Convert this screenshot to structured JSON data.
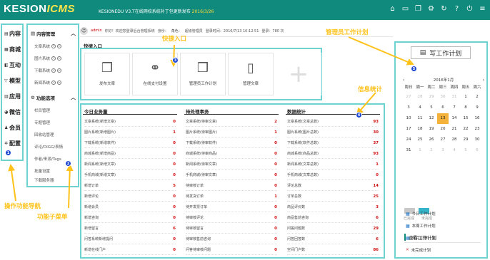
{
  "header": {
    "logo_main": "KESION",
    "logo_accent": "ICMS",
    "version_text": "KESIONEDU V3.T在线网校系统补丁包更新发布",
    "version_date": "2016/3/26",
    "icons": [
      "home-icon",
      "monitor-icon",
      "copy-icon",
      "gear-icon",
      "refresh-icon",
      "help-icon",
      "power-icon",
      "menu-icon"
    ]
  },
  "leftnav": {
    "items": [
      {
        "icon": "file-icon",
        "label": "内容"
      },
      {
        "icon": "shop-icon",
        "label": "商城"
      },
      {
        "icon": "interact-icon",
        "label": "互动"
      },
      {
        "icon": "model-icon",
        "label": "模型"
      },
      {
        "icon": "app-icon",
        "label": "应用"
      },
      {
        "icon": "wechat-icon",
        "label": "微信"
      },
      {
        "icon": "user-icon",
        "label": "会员"
      },
      {
        "icon": "config-icon",
        "label": "配置"
      }
    ]
  },
  "submenu": {
    "group1": "内容管理",
    "group1_items": [
      "文章系统",
      "图片系统",
      "下载系统",
      "新闻系统"
    ],
    "group2": "功能选项",
    "group2_items": [
      "栏目管理",
      "专题管理",
      "回收站管理",
      "评论/DIGG/表情",
      "作者/来源/Tags",
      "批量设置",
      "下载服务器"
    ]
  },
  "userbar": {
    "name": "admin",
    "text": "你好！欢迎您登录后台管理系统",
    "identity": "身份：",
    "role": "超级管理员",
    "role_label": "角色：",
    "last_login": "登录时间：2016/7/13 10:12:51",
    "count": "登录：780 次"
  },
  "quick": {
    "title": "快捷入口",
    "items": [
      {
        "icon": "doc-icon",
        "label": "发布文章"
      },
      {
        "icon": "link-icon",
        "label": "在线支付设置"
      },
      {
        "icon": "doc-icon",
        "label": "管理员工作计划"
      },
      {
        "icon": "mobile-icon",
        "label": "管理文章"
      },
      {
        "icon": "plus-icon",
        "label": ""
      }
    ]
  },
  "stats": {
    "col1_title": "今日业务量",
    "col1_rows": [
      {
        "label": "文章系统(新增文章)",
        "value": "0"
      },
      {
        "label": "图片系统(新增图片)",
        "value": "1"
      },
      {
        "label": "下载系统(新增软件)",
        "value": "0"
      },
      {
        "label": "商城系统(新增商品)",
        "value": "0"
      },
      {
        "label": "新闻系统(新增文章)",
        "value": "0"
      },
      {
        "label": "手机商城(新增文章)",
        "value": "0"
      },
      {
        "label": "新增订单",
        "value": "5"
      },
      {
        "label": "新增评论",
        "value": "0"
      },
      {
        "label": "新增会员",
        "value": "0"
      },
      {
        "label": "新增咨询",
        "value": "0"
      },
      {
        "label": "新增留言",
        "value": "6"
      },
      {
        "label": "问答系统新增提问",
        "value": "0"
      },
      {
        "label": "新增在线门户",
        "value": "0"
      },
      {
        "label": "新增友情链接",
        "value": "0"
      }
    ],
    "col2_title": "待处理事务",
    "col2_rows": [
      {
        "label": "文章系统(待审文章)",
        "value": "2"
      },
      {
        "label": "图片系统(待审图片)",
        "value": "1"
      },
      {
        "label": "下载系统(待审软件)",
        "value": "0"
      },
      {
        "label": "商城系统(待审商品)",
        "value": "0"
      },
      {
        "label": "新闻系统(待审文章)",
        "value": "0"
      },
      {
        "label": "手机商城(待审文章)",
        "value": "0"
      },
      {
        "label": "待审核订单",
        "value": "0"
      },
      {
        "label": "待发货订单",
        "value": "1"
      },
      {
        "label": "待开发票订单",
        "value": "0"
      },
      {
        "label": "待审核评论",
        "value": "0"
      },
      {
        "label": "待审核留言",
        "value": "0"
      },
      {
        "label": "待审核售前咨询",
        "value": "0"
      },
      {
        "label": "问答待审核问题",
        "value": "0"
      },
      {
        "label": "待审友链申请",
        "value": "0"
      }
    ],
    "col3_title": "数据统计",
    "col3_rows": [
      {
        "label": "文章系统(文章总数)",
        "value": "93"
      },
      {
        "label": "图片系统(图片总数)",
        "value": "30"
      },
      {
        "label": "下载系统(软件总数)",
        "value": "37"
      },
      {
        "label": "商城系统(商品总数)",
        "value": "93"
      },
      {
        "label": "新闻系统(文章总数)",
        "value": "1"
      },
      {
        "label": "手机商城(文章总数)",
        "value": "0"
      },
      {
        "label": "评论总数",
        "value": "14"
      },
      {
        "label": "订单总数",
        "value": "25"
      },
      {
        "label": "商品评价数",
        "value": "3"
      },
      {
        "label": "商品售前咨询",
        "value": "6"
      },
      {
        "label": "问答问题数",
        "value": "29"
      },
      {
        "label": "问答回答数",
        "value": "6"
      },
      {
        "label": "空间门户数",
        "value": "86"
      }
    ]
  },
  "calendar": {
    "write_label": "写工作计划",
    "month": "2016年1月",
    "weekdays": [
      "周日",
      "周一",
      "周二",
      "周三",
      "周四",
      "周五",
      "周六"
    ],
    "days": [
      [
        "27",
        "28",
        "29",
        "30",
        "31",
        "1",
        "2"
      ],
      [
        "3",
        "4",
        "5",
        "6",
        "7",
        "8",
        "9"
      ],
      [
        "10",
        "11",
        "12",
        "13",
        "14",
        "15",
        "16"
      ],
      [
        "17",
        "18",
        "19",
        "20",
        "21",
        "22",
        "23"
      ],
      [
        "24",
        "25",
        "26",
        "27",
        "28",
        "29",
        "30"
      ],
      [
        "31",
        "1",
        "2",
        "3",
        "4",
        "5",
        "6"
      ]
    ],
    "other_month_rows": [
      [
        0,
        0,
        0,
        0,
        0,
        1,
        1
      ],
      [
        1,
        1,
        1,
        1,
        1,
        1,
        1
      ],
      [
        1,
        1,
        1,
        1,
        1,
        1,
        1
      ],
      [
        1,
        1,
        1,
        1,
        1,
        1,
        1
      ],
      [
        1,
        1,
        1,
        1,
        1,
        1,
        1
      ],
      [
        1,
        0,
        0,
        0,
        0,
        0,
        0
      ]
    ],
    "today": "13",
    "legend_done": "已完成",
    "legend_todo": "未完成",
    "legend_done_color": "#c8c8c8",
    "legend_todo_color": "#35b3c9"
  },
  "workplan": {
    "title": "查看工作计划",
    "items": [
      {
        "icon": "calendar-icon",
        "label": "今日工作计划"
      },
      {
        "icon": "calendar-icon",
        "label": "本周工作计划"
      },
      {
        "icon": "calendar-icon",
        "label": "本月工作计划"
      },
      {
        "icon": "x-icon",
        "label": "未完成计划"
      }
    ]
  },
  "annotations": {
    "nav": "操作功能导航",
    "submenu": "功能子菜单",
    "quick": "快捷入口",
    "plan": "管理员工作计划",
    "stats": "信息统计",
    "badges": [
      "1",
      "2",
      "3",
      "4",
      "5"
    ]
  },
  "theme": {
    "accent": "#0f8a7c",
    "highlight": "#6ed3d0",
    "annotation": "#ffc21a"
  }
}
